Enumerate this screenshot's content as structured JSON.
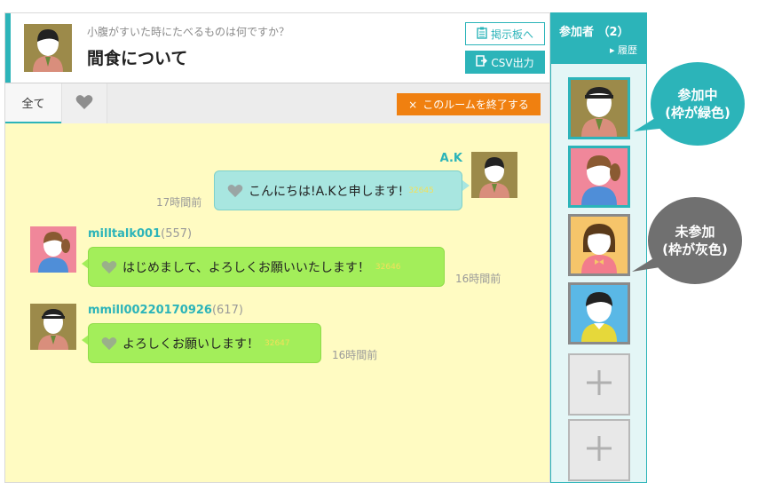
{
  "header": {
    "question": "小腹がすいた時にたべるものは何ですか？",
    "title": "間食について",
    "board_button": "掲示板へ",
    "csv_button": "CSV出力"
  },
  "tabs": {
    "all_label": "全て",
    "end_room_button": "このルームを終了する",
    "end_room_icon": "×"
  },
  "messages": [
    {
      "user": "A.K",
      "count": "",
      "text": "こんにちは!A.Kと申します!",
      "id": "32645",
      "time": "17時間前",
      "mine": true
    },
    {
      "user": "milltalk001",
      "count": "(557)",
      "text": "はじめまして、よろしくお願いいたします！",
      "id": "32646",
      "time": "16時間前",
      "mine": false
    },
    {
      "user": "mmill00220170926",
      "count": "(617)",
      "text": "よろしくお願いします！",
      "id": "32647",
      "time": "16時間前",
      "mine": false
    }
  ],
  "participants": {
    "title": "参加者 （2）",
    "history": "▸ 履歴"
  },
  "callouts": {
    "active_line1": "参加中",
    "active_line2": "(枠が緑色)",
    "inactive_line1": "未参加",
    "inactive_line2": "(枠が灰色)"
  },
  "colors": {
    "accent": "#2cb4b9",
    "end_button": "#f08010",
    "chat_background": "#fffbc2",
    "bubble_mine": "#a8e6e0",
    "bubble_other": "#a3ee5a"
  }
}
